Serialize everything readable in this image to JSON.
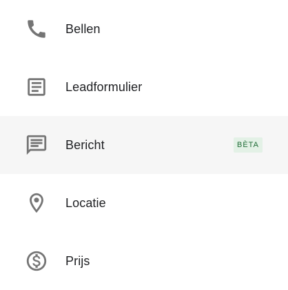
{
  "menu": {
    "items": [
      {
        "label": "Bellen",
        "icon": "phone-icon",
        "selected": false
      },
      {
        "label": "Leadformulier",
        "icon": "form-icon",
        "selected": false
      },
      {
        "label": "Bericht",
        "icon": "message-icon",
        "selected": true,
        "badge": "BÈTA"
      },
      {
        "label": "Locatie",
        "icon": "location-pin-icon",
        "selected": false
      },
      {
        "label": "Prijs",
        "icon": "dollar-icon",
        "selected": false
      }
    ]
  },
  "colors": {
    "icon": "#757575",
    "text": "#202124",
    "selected_background": "#f6f6f6",
    "badge_background": "#e3f1e6",
    "badge_text": "#1e6b35"
  }
}
